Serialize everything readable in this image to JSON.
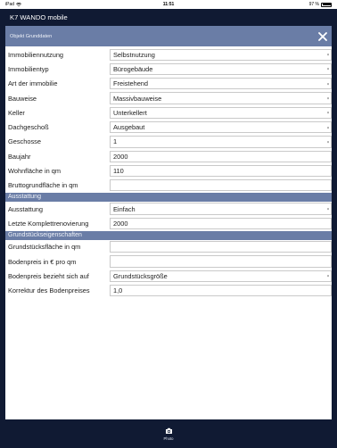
{
  "status": {
    "device": "iPad",
    "time": "11:51",
    "battery": "97 %"
  },
  "app": {
    "title": "K7 WANDO mobile"
  },
  "subheader": {
    "title": "Objekt Grunddaten"
  },
  "rows_main": [
    {
      "label": "Immobiliennutzung",
      "value": "Selbstnutzung",
      "dropdown": true
    },
    {
      "label": "Immobilientyp",
      "value": "Bürogebäude",
      "dropdown": true
    },
    {
      "label": "Art der immobilie",
      "value": "Freistehend",
      "dropdown": true
    },
    {
      "label": "Bauweise",
      "value": "Massivbauweise",
      "dropdown": true
    },
    {
      "label": "Keller",
      "value": "Unterkellert",
      "dropdown": true
    },
    {
      "label": "Dachgeschoß",
      "value": "Ausgebaut",
      "dropdown": true
    },
    {
      "label": "Geschosse",
      "value": "1",
      "dropdown": true
    },
    {
      "label": "Baujahr",
      "value": "2000",
      "dropdown": false
    },
    {
      "label": "Wohnfläche in qm",
      "value": "110",
      "dropdown": false
    },
    {
      "label": "Bruttogrundfläche in qm",
      "value": "",
      "dropdown": false
    }
  ],
  "section_ausstattung": "Ausstattung",
  "rows_ausstattung": [
    {
      "label": "Ausstattung",
      "value": "Einfach",
      "dropdown": true
    },
    {
      "label": "Letzte Komplettrenovierung",
      "value": "2000",
      "dropdown": false
    }
  ],
  "section_grund": "Grundstückseigenschaften",
  "rows_grund": [
    {
      "label": "Grundstücksfläche in qm",
      "value": "",
      "dropdown": false
    },
    {
      "label": "Bodenpreis in € pro qm",
      "value": "",
      "dropdown": false
    },
    {
      "label": "Bodenpreis bezieht sich auf",
      "value": "Grundstücksgröße",
      "dropdown": true
    },
    {
      "label": "Korrektur des Bodenpreises",
      "value": "1,0",
      "dropdown": false
    }
  ],
  "toolbar": {
    "photo_label": "Photo"
  },
  "colors": {
    "navy": "#101a33",
    "header_blue": "#6a7da6"
  },
  "icons": {
    "close": "close-icon",
    "camera": "camera-icon",
    "wifi": "wifi-icon",
    "battery": "battery-icon",
    "dropdown": "chevron-down-icon"
  }
}
